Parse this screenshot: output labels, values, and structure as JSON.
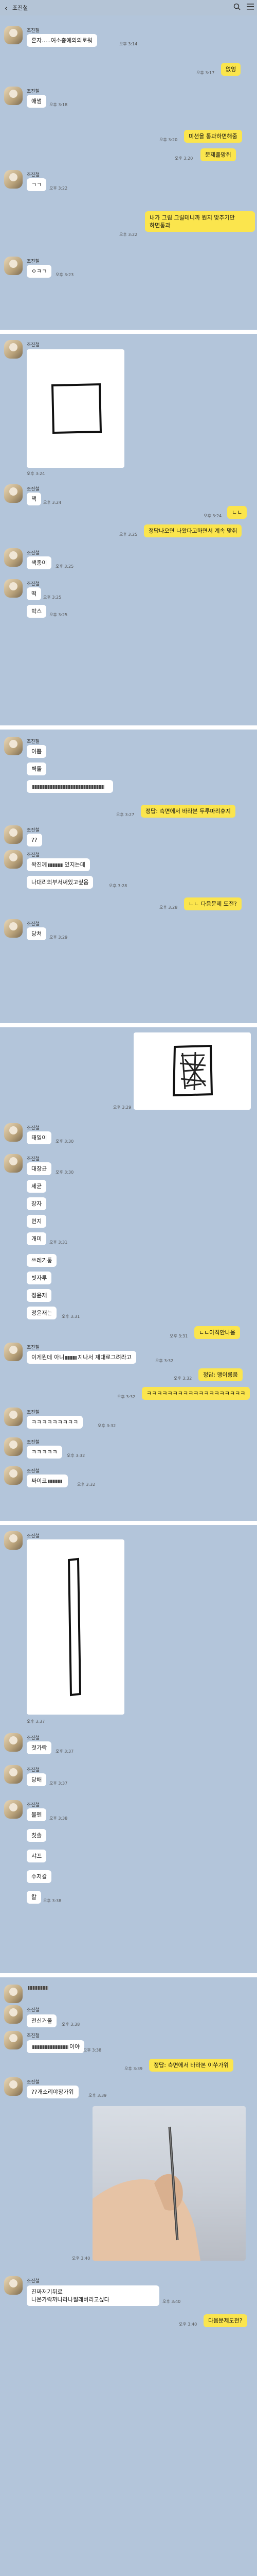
{
  "header": {
    "back_icon": "back-chevron-icon",
    "title": "조진철",
    "search_icon": "search-icon",
    "menu_icon": "menu-icon"
  },
  "contact": {
    "name": "조진철"
  },
  "panel1": {
    "m1": {
      "text": "혼자.....여소충예의의로워",
      "time": "오후 3:14"
    },
    "m2": {
      "text": "없엉",
      "time": "오후 3:17"
    },
    "m3": {
      "text": "애썸",
      "time": "오후 3:18"
    },
    "m4": {
      "text": "미션을 통과하면해줌",
      "time": "오후 3:20"
    },
    "m5": {
      "text": "문제풀망쥐",
      "time": "오후 3:20"
    },
    "m6": {
      "text": "ㄱㄱ",
      "time": "오후 3:22"
    },
    "m7": {
      "line1": "내가 그림 그릴테니까 뭔지 맞추기만",
      "line2": "하면통과",
      "time": "오후 3:22"
    },
    "m8": {
      "text": "ㅇㅋㄱ",
      "time": "오후 3:23"
    }
  },
  "panel2": {
    "image_time": "오후 3:24",
    "m1": {
      "text": "책",
      "time": "오후 3:24"
    },
    "m2": {
      "text": "ㄴㄴ",
      "time": "오후 3:24"
    },
    "m3": {
      "text": "정답나오면 나왔다고하면서 계속 맞춰",
      "time": "오후 3:25"
    },
    "m4": {
      "text": "색종이",
      "time": "오후 3:25"
    },
    "m5": {
      "text": "떡",
      "time": "오후 3:25"
    },
    "m6": {
      "text": "박스",
      "time": "오후 3:25"
    }
  },
  "panel3": {
    "m1": {
      "text": "이쁨"
    },
    "m2": {
      "text": "벽돌"
    },
    "m3": {
      "text": ""
    },
    "m4": {
      "text": "정답: 측면에서 바라본 두루마리휴지",
      "time": "오후 3:27"
    },
    "m5": {
      "text": "??"
    },
    "m6": {
      "text": "왁진께",
      "suffix": "있지는데"
    },
    "m7": {
      "text": "나대리의부서써있고싶음",
      "time": "오후 3:28"
    },
    "m8": {
      "text": "ㄴㄴ 다음문제 도전?",
      "time": "오후 3:28"
    },
    "m9": {
      "text": "당쳐",
      "time": "오후 3:29"
    }
  },
  "panel4": {
    "image_time": "오후 3:29",
    "m1": {
      "text": "태일이",
      "time": "오후 3:30"
    },
    "m2": {
      "text": "대장균",
      "time": "오후 3:30"
    },
    "m3": {
      "text": "세균"
    },
    "m4": {
      "text": "장자"
    },
    "m5": {
      "text": "먼지"
    },
    "m6": {
      "text": "개미",
      "time": "오후 3:31"
    },
    "m7": {
      "text": "쓰레기통"
    },
    "m8": {
      "text": "빗자루"
    },
    "m9": {
      "text": "정윤재"
    },
    "m10": {
      "text": "정윤재는",
      "time": "오후 3:31"
    },
    "m11": {
      "text": "ㄴㄴ아직안나옴",
      "time": "오후 3:31"
    },
    "m12": {
      "text": "이게뭔데 아니",
      "suffix": "지나서 제대로그려라고",
      "time": "오후 3:32"
    },
    "m13": {
      "text": "정답: 맹이롱움",
      "time": "오후 3:32"
    },
    "m14": {
      "text": "ㅋㅋㅋㅋㅋㅋㅋㅋㅋㅋㅋㅋㅋㅋㅋㅋㅋㅋㅋ",
      "time": "오후 3:32"
    },
    "m15": {
      "text": "ㅋㅋㅋㅋㅋㅋㅋㅋㅋ",
      "time": "오후 3:32"
    },
    "m16": {
      "text": "ㅋㅋㅋㅋㅋ",
      "time": "오후 3:32"
    },
    "m17": {
      "text": "싸이코",
      "suffix": "",
      "time": "오후 3:32"
    }
  },
  "panel5": {
    "image_time": "오후 3:37",
    "m1": {
      "text": "젓가락",
      "time": "오후 3:37"
    },
    "m2": {
      "text": "당배",
      "time": "오후 3:37"
    },
    "m3": {
      "text": "볼펜",
      "time": "오후 3:38"
    },
    "m4": {
      "text": "칫솔"
    },
    "m5": {
      "text": "샤프"
    },
    "m6": {
      "text": "수저칼"
    },
    "m7": {
      "text": "칼",
      "time": "오후 3:38"
    }
  },
  "panel6": {
    "m1": {
      "text": "전신거울",
      "time": "오후 3:38"
    },
    "m2": {
      "text": "",
      "suffix": "이야",
      "time": "오후 3:38"
    },
    "m3": {
      "text": "정답: 측면에서 바라본 이쑤가위",
      "time": "오후 3:39"
    },
    "m4": {
      "text": "??개소리야장가위",
      "time": "오후 3:39"
    },
    "image_time": "오후 3:40",
    "m5": {
      "line1": "진짜저기뒤로",
      "line2": "나온가락까나라나쩔래버리고싶다",
      "time": "오후 3:40"
    },
    "m6": {
      "text": "다음문제도전?",
      "time": "오후 3:40"
    }
  }
}
